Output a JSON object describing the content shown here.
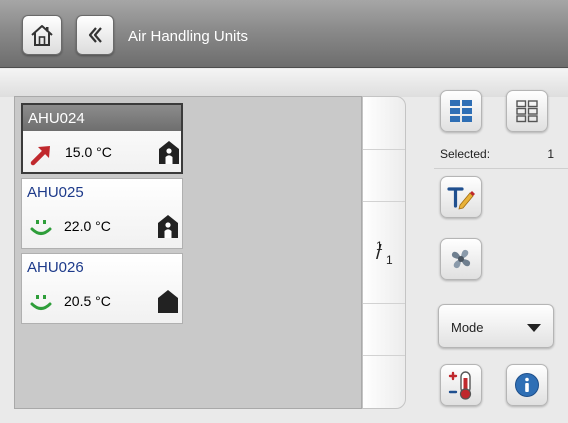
{
  "header": {
    "title": "Air Handling Units",
    "home_icon": "home-icon",
    "back_icon": "chevron-left-icon"
  },
  "units": [
    {
      "name": "AHU024",
      "temperature": "15.0 °C",
      "status_icon": "arrow-up-right-icon",
      "mode_icon": "house-person-icon",
      "selected": true
    },
    {
      "name": "AHU025",
      "temperature": "22.0 °C",
      "status_icon": "smiley-icon",
      "mode_icon": "house-person-icon",
      "selected": false
    },
    {
      "name": "AHU026",
      "temperature": "20.5 °C",
      "status_icon": "smiley-icon",
      "mode_icon": "house-icon",
      "selected": false
    }
  ],
  "pager": {
    "current": "1",
    "total": "1"
  },
  "toolbar": {
    "selected_label": "Selected:",
    "selected_count": "1",
    "mode_label": "Mode",
    "icons": [
      "view-large-icon",
      "view-small-icon",
      "rename-icon",
      "fan-icon",
      "setpoint-icon",
      "info-icon"
    ]
  },
  "colors": {
    "header_gradient_top": "#a6a6a6",
    "header_gradient_bottom": "#6d6d6d",
    "unit_name": "#1d3a8a",
    "alert_arrow": "#c0282d",
    "ok_smiley": "#2e9e3a",
    "view_icon_blue": "#2f6fb5",
    "info_blue": "#2f6fb5"
  }
}
